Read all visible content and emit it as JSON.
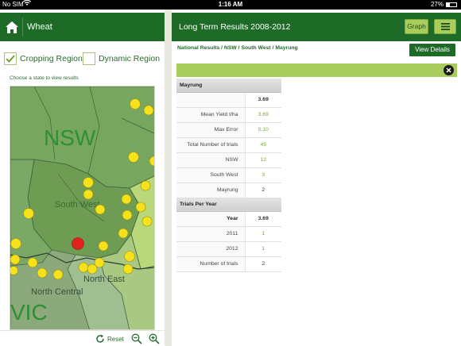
{
  "status_bar": {
    "carrier": "No SIM",
    "time": "1:16 AM",
    "battery": "27%"
  },
  "left": {
    "title": "Wheat",
    "legend": {
      "cropping_region": "Cropping Region",
      "dynamic_region": "Dynamic Region"
    },
    "choose_state": "Choose a state to view results",
    "map": {
      "labels": {
        "nsw": "NSW",
        "south_west": "South West",
        "north_east": "North East",
        "north_central": "North Central",
        "vic": "VIC"
      }
    },
    "toolbar": {
      "reset": "Reset"
    }
  },
  "right": {
    "title": "Long Term Results 2008-2012",
    "graph_button": "Graph",
    "breadcrumb": "National Results  /  NSW  /  South West  /  Mayrung",
    "view_details": "View Details",
    "table": {
      "site_header": "Mayrung",
      "site_value": "3.69",
      "rows": [
        {
          "label": "Mean Yield t/ha",
          "value": "3.69"
        },
        {
          "label": "Max Error",
          "value": "0.10"
        },
        {
          "label": "Total Number of trials",
          "value": "45"
        },
        {
          "label": "NSW",
          "value": "12"
        },
        {
          "label": "South West",
          "value": "3"
        },
        {
          "label": "Mayrung",
          "value": "2"
        }
      ],
      "trials_header": "Trials Per Year",
      "year_label": "Year",
      "year_value": "3.69",
      "year_rows": [
        {
          "label": "2011",
          "value": "1"
        },
        {
          "label": "2012",
          "value": "1"
        },
        {
          "label": "Number of trials",
          "value": "2"
        }
      ]
    }
  },
  "colors": {
    "header_green": "#1e6b28",
    "accent_lime": "#a8cd5d",
    "marker_yellow": "#f5e21a",
    "marker_red": "#e0221a"
  }
}
